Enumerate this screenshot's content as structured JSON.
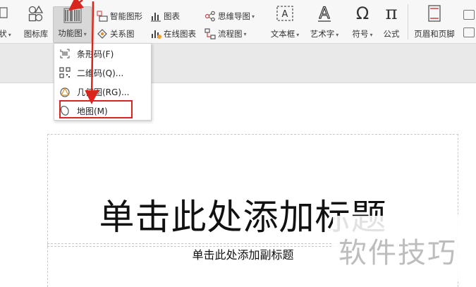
{
  "ribbon": {
    "items": [
      {
        "id": "shape",
        "label": "状"
      },
      {
        "id": "icon-lib",
        "label": "图标库"
      },
      {
        "id": "func-fig",
        "label": "功能图"
      },
      {
        "id": "smart-art",
        "label": "智能图形"
      },
      {
        "id": "relation",
        "label": "关系图"
      },
      {
        "id": "chart",
        "label": "图表"
      },
      {
        "id": "online-chart",
        "label": "在线图表"
      },
      {
        "id": "mindmap",
        "label": "思维导图"
      },
      {
        "id": "flowchart",
        "label": "流程图"
      },
      {
        "id": "textbox",
        "label": "文本框"
      },
      {
        "id": "wordart",
        "label": "艺术字"
      },
      {
        "id": "symbol",
        "label": "符号"
      },
      {
        "id": "formula",
        "label": "公式"
      },
      {
        "id": "header-footer",
        "label": "页眉和页脚"
      }
    ],
    "icons": {
      "textbox": "A",
      "wordart": "A",
      "symbol": "Ω",
      "formula": "π"
    }
  },
  "menu": {
    "items": [
      {
        "label": "条形码(F)"
      },
      {
        "label": "二维码(Q)..."
      },
      {
        "label": "几何图(RG)..."
      },
      {
        "label": "地图(M)"
      }
    ]
  },
  "slide": {
    "title_placeholder": "单击此处添加标题",
    "subtitle_placeholder": "单击此处添加副标题"
  },
  "watermark": {
    "text": "软件技巧"
  },
  "colors": {
    "annotation": "#d9261c",
    "ribbon_bg": "#f7f7f7",
    "band_bg": "#e9e9e9"
  }
}
